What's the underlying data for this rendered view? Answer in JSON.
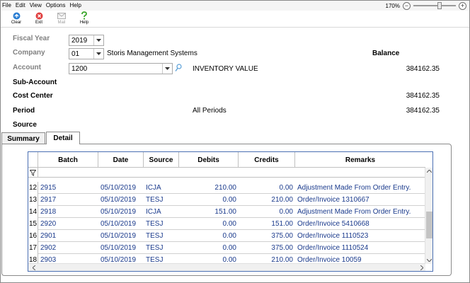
{
  "menubar": {
    "items": [
      "File",
      "Edit",
      "View",
      "Options",
      "Help"
    ],
    "zoom_label": "170%"
  },
  "toolbar": {
    "clear": "Clear",
    "exit": "Exit",
    "mail": "Mail",
    "help": "Help"
  },
  "form": {
    "fiscal_year_label": "Fiscal Year",
    "fiscal_year_value": "2019",
    "company_label": "Company",
    "company_value": "01",
    "company_name": "Storis Management Systems",
    "balance_label": "Balance",
    "account_label": "Account",
    "account_value": "1200",
    "account_name": "INVENTORY VALUE",
    "account_balance": "384162.35",
    "sub_account_label": "Sub-Account",
    "cost_center_label": "Cost Center",
    "cost_center_balance": "384162.35",
    "period_label": "Period",
    "period_value": "All Periods",
    "period_balance": "384162.35",
    "source_label": "Source"
  },
  "tabs": [
    "Summary",
    "Detail"
  ],
  "grid": {
    "columns": [
      "Batch",
      "Date",
      "Source",
      "Debits",
      "Credits",
      "Remarks"
    ],
    "rows": [
      {
        "n": "12",
        "batch": "2915",
        "date": "05/10/2019",
        "source": "ICJA",
        "debits": "210.00",
        "credits": "0.00",
        "remarks": "Adjustment Made From Order Entry."
      },
      {
        "n": "13",
        "batch": "2917",
        "date": "05/10/2019",
        "source": "TESJ",
        "debits": "0.00",
        "credits": "210.00",
        "remarks": "Order/Invoice 1310667"
      },
      {
        "n": "14",
        "batch": "2918",
        "date": "05/10/2019",
        "source": "ICJA",
        "debits": "151.00",
        "credits": "0.00",
        "remarks": "Adjustment Made From Order Entry."
      },
      {
        "n": "15",
        "batch": "2920",
        "date": "05/10/2019",
        "source": "TESJ",
        "debits": "0.00",
        "credits": "151.00",
        "remarks": "Order/Invoice 5410668"
      },
      {
        "n": "16",
        "batch": "2901",
        "date": "05/10/2019",
        "source": "TESJ",
        "debits": "0.00",
        "credits": "375.00",
        "remarks": "Order/Invoice 1110523"
      },
      {
        "n": "17",
        "batch": "2902",
        "date": "05/10/2019",
        "source": "TESJ",
        "debits": "0.00",
        "credits": "375.00",
        "remarks": "Order/Invoice 1110524"
      },
      {
        "n": "18",
        "batch": "2903",
        "date": "05/10/2019",
        "source": "TESJ",
        "debits": "0.00",
        "credits": "210.00",
        "remarks": "Order/Invoice 10059"
      }
    ]
  }
}
